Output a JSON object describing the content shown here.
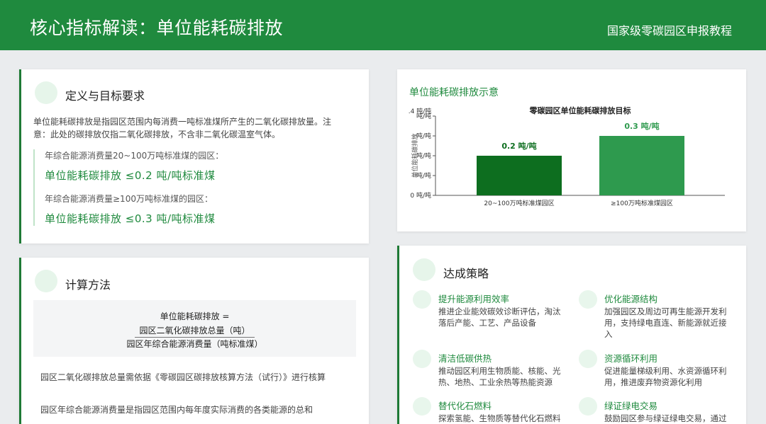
{
  "header": {
    "title": "核心指标解读：单位能耗碳排放",
    "subtitle": "国家级零碳园区申报教程"
  },
  "definition": {
    "title": "定义与目标要求",
    "description": "单位能耗碳排放是指园区范围内每消费一吨标准煤所产生的二氧化碳排放量。注意：此处的碳排放仅指二氧化碳排放，不含非二氧化碳温室气体。",
    "tier1_label": "年综合能源消费量20~100万吨标准煤的园区：",
    "tier1_value": "单位能耗碳排放 ≤0.2 吨/吨标准煤",
    "tier2_label": "年综合能源消费量≥100万吨标准煤的园区：",
    "tier2_value": "单位能耗碳排放 ≤0.3 吨/吨标准煤"
  },
  "calculation": {
    "title": "计算方法",
    "formula_line1": "单位能耗碳排放 =",
    "formula_numerator": "园区二氧化碳排放总量（吨）",
    "formula_denominator": "园区年综合能源消费量（吨标准煤）",
    "note1": "园区二氧化碳排放总量需依据《零碳园区碳排放核算方法（试行）》进行核算",
    "note2": "园区年综合能源消费量是指园区范围内每年度实际消费的各类能源的总和"
  },
  "chart_section": {
    "title": "单位能耗碳排放示意"
  },
  "chart_data": {
    "type": "bar",
    "title": "零碳园区单位能耗碳排放目标",
    "categories": [
      "20~100万吨标准煤园区",
      "≥100万吨标准煤园区"
    ],
    "values": [
      0.2,
      0.3
    ],
    "value_labels": [
      "0.2 吨/吨",
      "0.3 吨/吨"
    ],
    "ylabel": "单位能耗碳排放",
    "ylim": [
      0,
      0.4
    ],
    "yticks": [
      "0 吨/吨",
      "吨/吨",
      "吨/吨",
      "吨/吨",
      "吨/吨"
    ],
    "ytick_top": ".4 吨/吨",
    "colors": [
      "#0d6e1f",
      "#2e9a4e"
    ],
    "grid": false
  },
  "strategy": {
    "title": "达成策略",
    "items": [
      {
        "heading": "提升能源利用效率",
        "text": "推进企业能效碳效诊断评估，淘汰落后产能、工艺、产品设备"
      },
      {
        "heading": "优化能源结构",
        "text": "加强园区及周边可再生能源开发利用，支持绿电直连、新能源就近接入"
      },
      {
        "heading": "清洁低碳供热",
        "text": "推动园区利用生物质能、核能、光热、地热、工业余热等热能资源"
      },
      {
        "heading": "资源循环利用",
        "text": "促进能量梯级利用、水资源循环利用，推进废弃物资源化利用"
      },
      {
        "heading": "替代化石燃料",
        "text": "探索氢能、生物质等替代化石燃料"
      },
      {
        "heading": "绿证绿电交易",
        "text": "鼓励园区参与绿证绿电交易，通过"
      }
    ]
  }
}
